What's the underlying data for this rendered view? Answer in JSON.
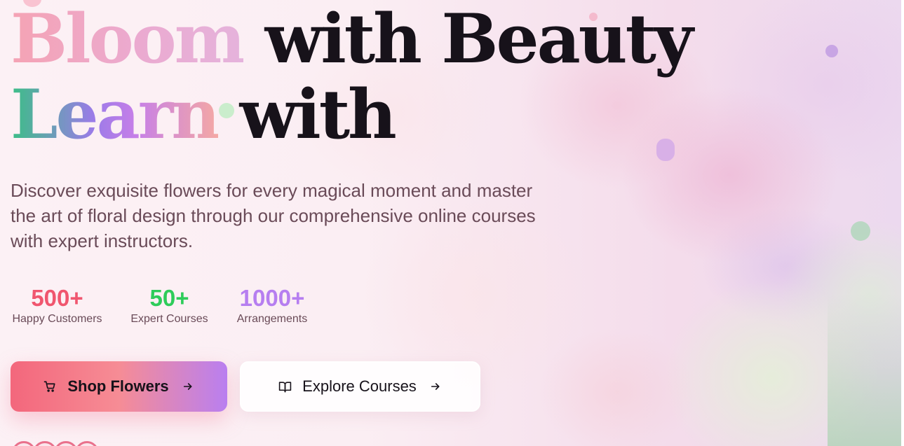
{
  "hero": {
    "title_line1_accent": "Bloom",
    "title_line1_rest": " with Beauty",
    "title_line2_accent": "Learn",
    "title_line2_rest": " with",
    "subtitle": "Discover exquisite flowers for every magical moment and master the art of floral design through our comprehensive online courses with expert instructors.",
    "stats": [
      {
        "value": "500+",
        "label": "Happy Customers",
        "color": "#f0566f"
      },
      {
        "value": "50+",
        "label": "Expert Courses",
        "color": "#2ecc5a"
      },
      {
        "value": "1000+",
        "label": "Arrangements",
        "color": "#b67ef0"
      }
    ],
    "buttons": {
      "primary": {
        "label": "Shop Flowers",
        "icon": "shopping-cart-icon",
        "trailing_icon": "arrow-right-icon"
      },
      "secondary": {
        "label": "Explore Courses",
        "icon": "book-open-icon",
        "trailing_icon": "arrow-right-icon"
      }
    }
  },
  "colors": {
    "heading": "#17121a",
    "body_text": "#6a4b58",
    "accent_pink": "#f3677c",
    "accent_purple": "#b97ff0",
    "accent_green": "#2ecc5a"
  }
}
